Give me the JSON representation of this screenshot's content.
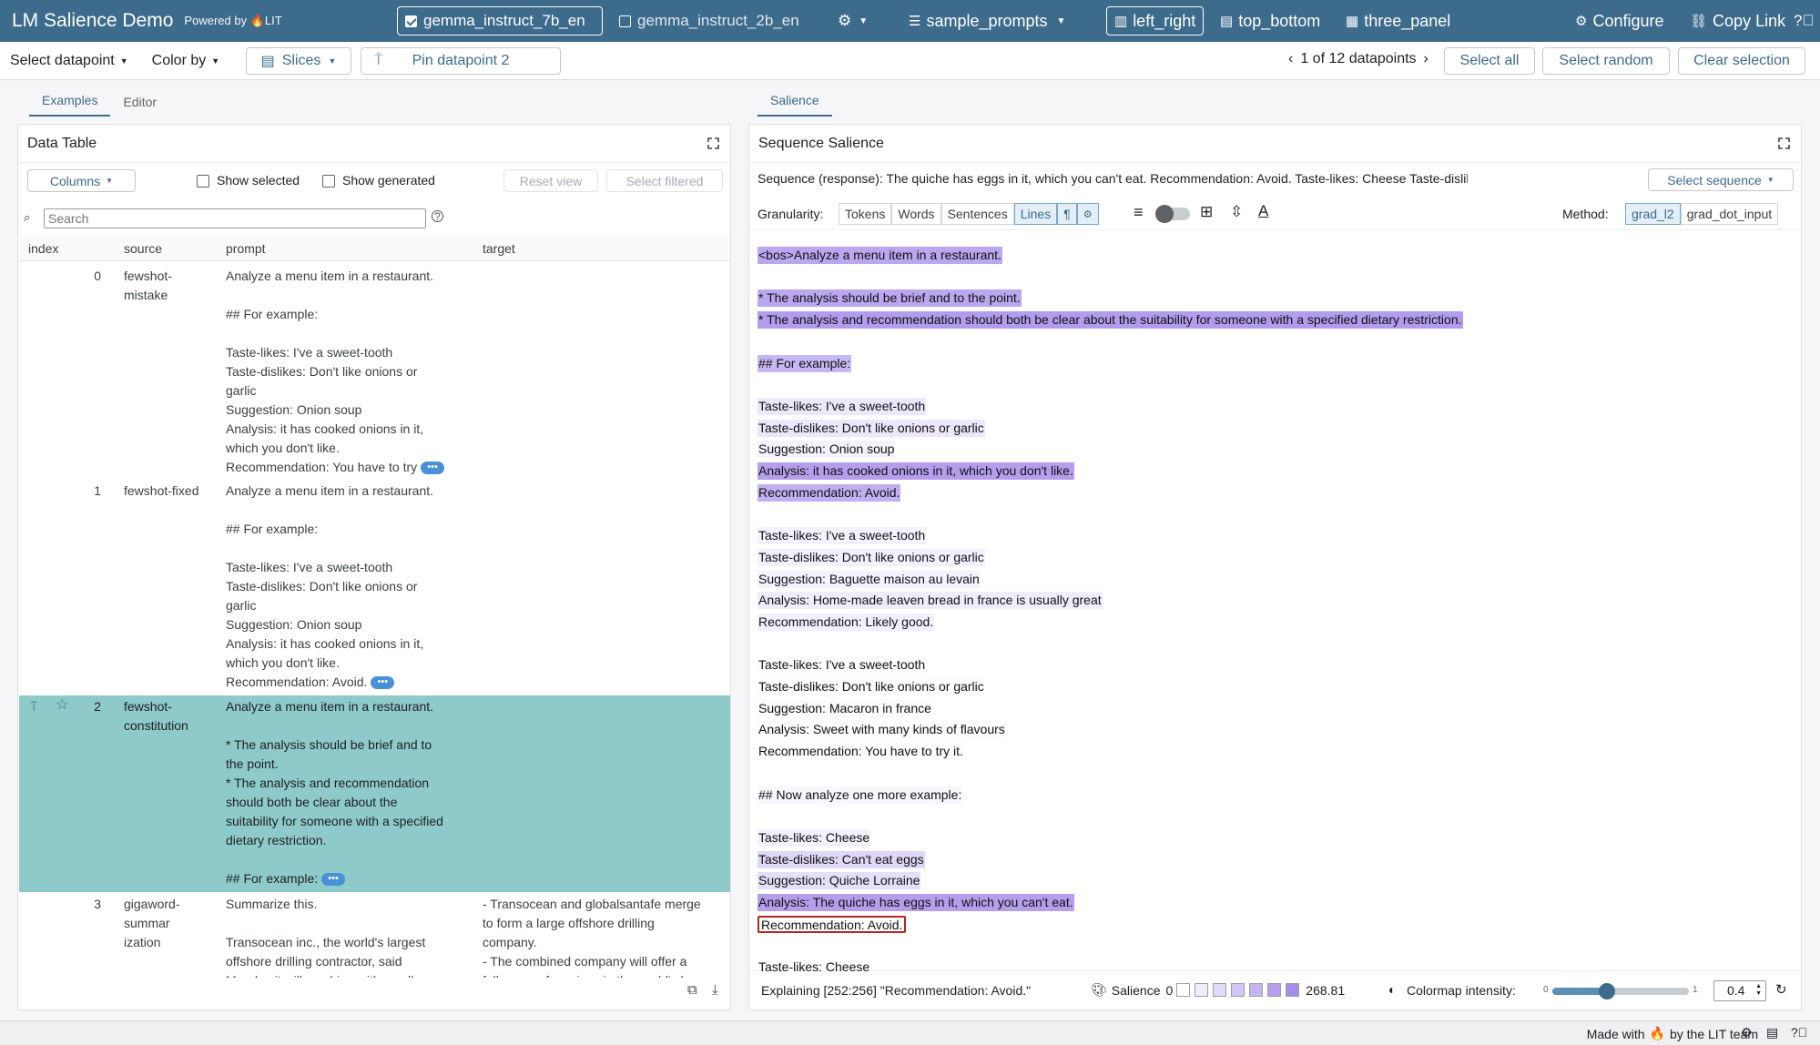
{
  "app": {
    "title": "LM Salience Demo",
    "powered_by": "Powered by",
    "lit_logo": "LIT"
  },
  "models": [
    {
      "label": "gemma_instruct_7b_en",
      "checked": true
    },
    {
      "label": "gemma_instruct_2b_en",
      "checked": false
    }
  ],
  "dataset": "sample_prompts",
  "layouts": [
    {
      "label": "left_right",
      "selected": true
    },
    {
      "label": "top_bottom",
      "selected": false
    },
    {
      "label": "three_panel",
      "selected": false
    }
  ],
  "top_actions": {
    "configure": "Configure",
    "copy_link": "Copy Link"
  },
  "toolbar": {
    "select_datapoint": "Select datapoint",
    "color_by": "Color by",
    "slices": "Slices",
    "pin": "Pin datapoint 2",
    "nav": "1 of 12 datapoints",
    "select_all": "Select all",
    "select_random": "Select random",
    "clear_selection": "Clear selection"
  },
  "left": {
    "tabs": [
      "Examples",
      "Editor"
    ],
    "title": "Data Table",
    "columns_btn": "Columns",
    "show_selected": "Show selected",
    "show_generated": "Show generated",
    "reset_view": "Reset view",
    "select_filtered": "Select filtered",
    "search_placeholder": "Search",
    "headers": [
      "index",
      "source",
      "prompt",
      "target"
    ],
    "rows": [
      {
        "index": "0",
        "source": "fewshot-\nmistake",
        "prompt": "Analyze a menu item in a restaurant.\n\n## For example:\n\nTaste-likes: I've a sweet-tooth\nTaste-dislikes: Don't like onions or\ngarlic\nSuggestion: Onion soup\nAnalysis: it has cooked onions in it,\nwhich you don't like.\nRecommendation: You have to try",
        "target": ""
      },
      {
        "index": "1",
        "source": "fewshot-fixed",
        "prompt": "Analyze a menu item in a restaurant.\n\n## For example:\n\nTaste-likes: I've a sweet-tooth\nTaste-dislikes: Don't like onions or\ngarlic\nSuggestion: Onion soup\nAnalysis: it has cooked onions in it,\nwhich you don't like.\nRecommendation: Avoid.",
        "target": ""
      },
      {
        "index": "2",
        "source": "fewshot-\nconstitution",
        "prompt": "Analyze a menu item in a restaurant.\n\n* The analysis should be brief and to\nthe point.\n* The analysis and recommendation\nshould both be clear about the\nsuitability for someone with a specified\ndietary restriction.\n\n## For example:",
        "target": ""
      },
      {
        "index": "3",
        "source": "gigaword-\nsummar\nization",
        "prompt": "Summarize this.\n\nTransocean inc., the world's largest\noffshore drilling contractor, said\nMonday it will combine with smaller",
        "target": "- Transocean and globalsantafe merge\nto form a large offshore drilling\ncompany.\n- The combined company will offer a\nfull range of services in the world's key"
      }
    ]
  },
  "right": {
    "tab": "Salience",
    "title": "Sequence Salience",
    "sequence_label": "Sequence (response):",
    "sequence_text": "The quiche has eggs in it, which you can't eat. Recommendation: Avoid. Taste-likes: Cheese Taste-dislikes: Can't eat egg...",
    "select_sequence": "Select sequence",
    "granularity_label": "Granularity:",
    "granularity": [
      "Tokens",
      "Words",
      "Sentences",
      "Lines"
    ],
    "granularity_selected": "Lines",
    "method_label": "Method:",
    "methods": [
      "grad_l2",
      "grad_dot_input"
    ],
    "method_selected": "grad_l2",
    "lines": [
      {
        "t": "<bos>Analyze a menu item in a restaurant.",
        "s": 0.55
      },
      {
        "t": "",
        "s": 0
      },
      {
        "t": "* The analysis should be brief and to the point.",
        "s": 0.55
      },
      {
        "t": "* The analysis and recommendation should both be clear about the suitability for someone with a specified dietary restriction.",
        "s": 0.62
      },
      {
        "t": "",
        "s": 0.1
      },
      {
        "t": "## For example:",
        "s": 0.45
      },
      {
        "t": "",
        "s": 0.05
      },
      {
        "t": "Taste-likes: I've a sweet-tooth",
        "s": 0.15
      },
      {
        "t": "Taste-dislikes: Don't like onions or garlic",
        "s": 0.15
      },
      {
        "t": "Suggestion: Onion soup",
        "s": 0.08
      },
      {
        "t": "Analysis: it has cooked onions in it, which you don't like.",
        "s": 0.6
      },
      {
        "t": "Recommendation: Avoid.",
        "s": 0.5
      },
      {
        "t": "",
        "s": 0
      },
      {
        "t": "Taste-likes: I've a sweet-tooth",
        "s": 0.08
      },
      {
        "t": "Taste-dislikes: Don't like onions or garlic",
        "s": 0.1
      },
      {
        "t": "Suggestion: Baguette maison au levain",
        "s": 0.08
      },
      {
        "t": "Analysis: Home-made leaven bread in france is usually great",
        "s": 0.12
      },
      {
        "t": "Recommendation: Likely good.",
        "s": 0.1
      },
      {
        "t": "",
        "s": 0
      },
      {
        "t": "Taste-likes: I've a sweet-tooth",
        "s": 0.03
      },
      {
        "t": "Taste-dislikes: Don't like onions or garlic",
        "s": 0.03
      },
      {
        "t": "Suggestion: Macaron in france",
        "s": 0.03
      },
      {
        "t": "Analysis: Sweet with many kinds of flavours",
        "s": 0.03
      },
      {
        "t": "Recommendation: You have to try it.",
        "s": 0.03
      },
      {
        "t": "",
        "s": 0
      },
      {
        "t": "## Now analyze one more example:",
        "s": 0.05
      },
      {
        "t": "",
        "s": 0
      },
      {
        "t": "Taste-likes: Cheese",
        "s": 0.1
      },
      {
        "t": "Taste-dislikes: Can't eat eggs",
        "s": 0.25
      },
      {
        "t": "Suggestion: Quiche Lorraine",
        "s": 0.2
      },
      {
        "t": "Analysis: The quiche has eggs in it, which you can't eat.",
        "s": 0.6
      },
      {
        "t": "Recommendation: Avoid.",
        "s": 0,
        "target": true
      },
      {
        "t": "",
        "s": 0
      },
      {
        "t": "Taste-likes: Cheese",
        "s": 0
      }
    ],
    "explaining": "Explaining [252:256] \"Recommendation: Avoid.\"",
    "salience_label": "Salience",
    "salience_min": "0",
    "salience_max": "268.81",
    "colormap_label": "Colormap intensity:",
    "slider_min": "0",
    "slider_max": "1",
    "slider_value": 0.4,
    "intensity_value": "0.4"
  },
  "footer": {
    "made_with": "Made with",
    "by": "by the LIT team"
  },
  "colors": {
    "topbar": "#3d6b8c",
    "salience": "#c5b3f2",
    "selected_row": "#8ecac9",
    "target_border": "#b3261e"
  }
}
